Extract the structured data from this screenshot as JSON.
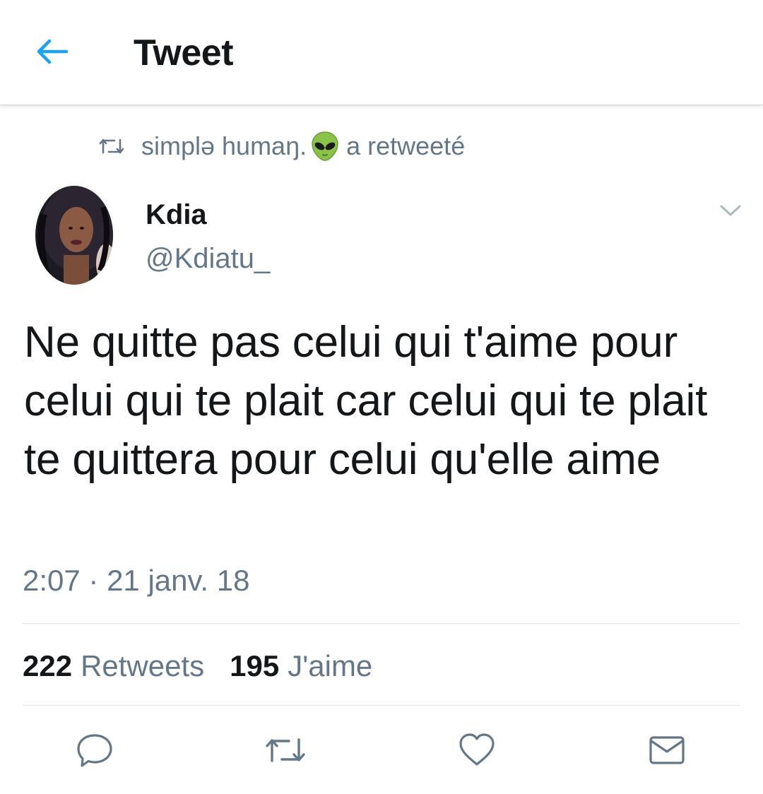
{
  "header": {
    "title": "Tweet",
    "back_icon": "arrow-left-icon",
    "accent": "#1da1f2"
  },
  "retweet_context": {
    "user": "simplə humaŋ.",
    "emoji": "👽",
    "suffix": "a retweeté"
  },
  "tweet": {
    "author_name": "Kdia",
    "author_handle": "@Kdiatu_",
    "text": "Ne quitte pas celui qui t'aime pour celui qui te plait car celui qui te plait te quittera pour celui qu'elle aime",
    "timestamp": "2:07 · 21 janv. 18"
  },
  "stats": {
    "retweets_count": "222",
    "retweets_label": "Retweets",
    "likes_count": "195",
    "likes_label": "J'aime"
  },
  "actions": [
    "reply-icon",
    "retweet-icon",
    "like-icon",
    "direct-message-icon"
  ],
  "colors": {
    "text_primary": "#14171a",
    "text_secondary": "#657786",
    "divider": "#e1e8ed"
  }
}
